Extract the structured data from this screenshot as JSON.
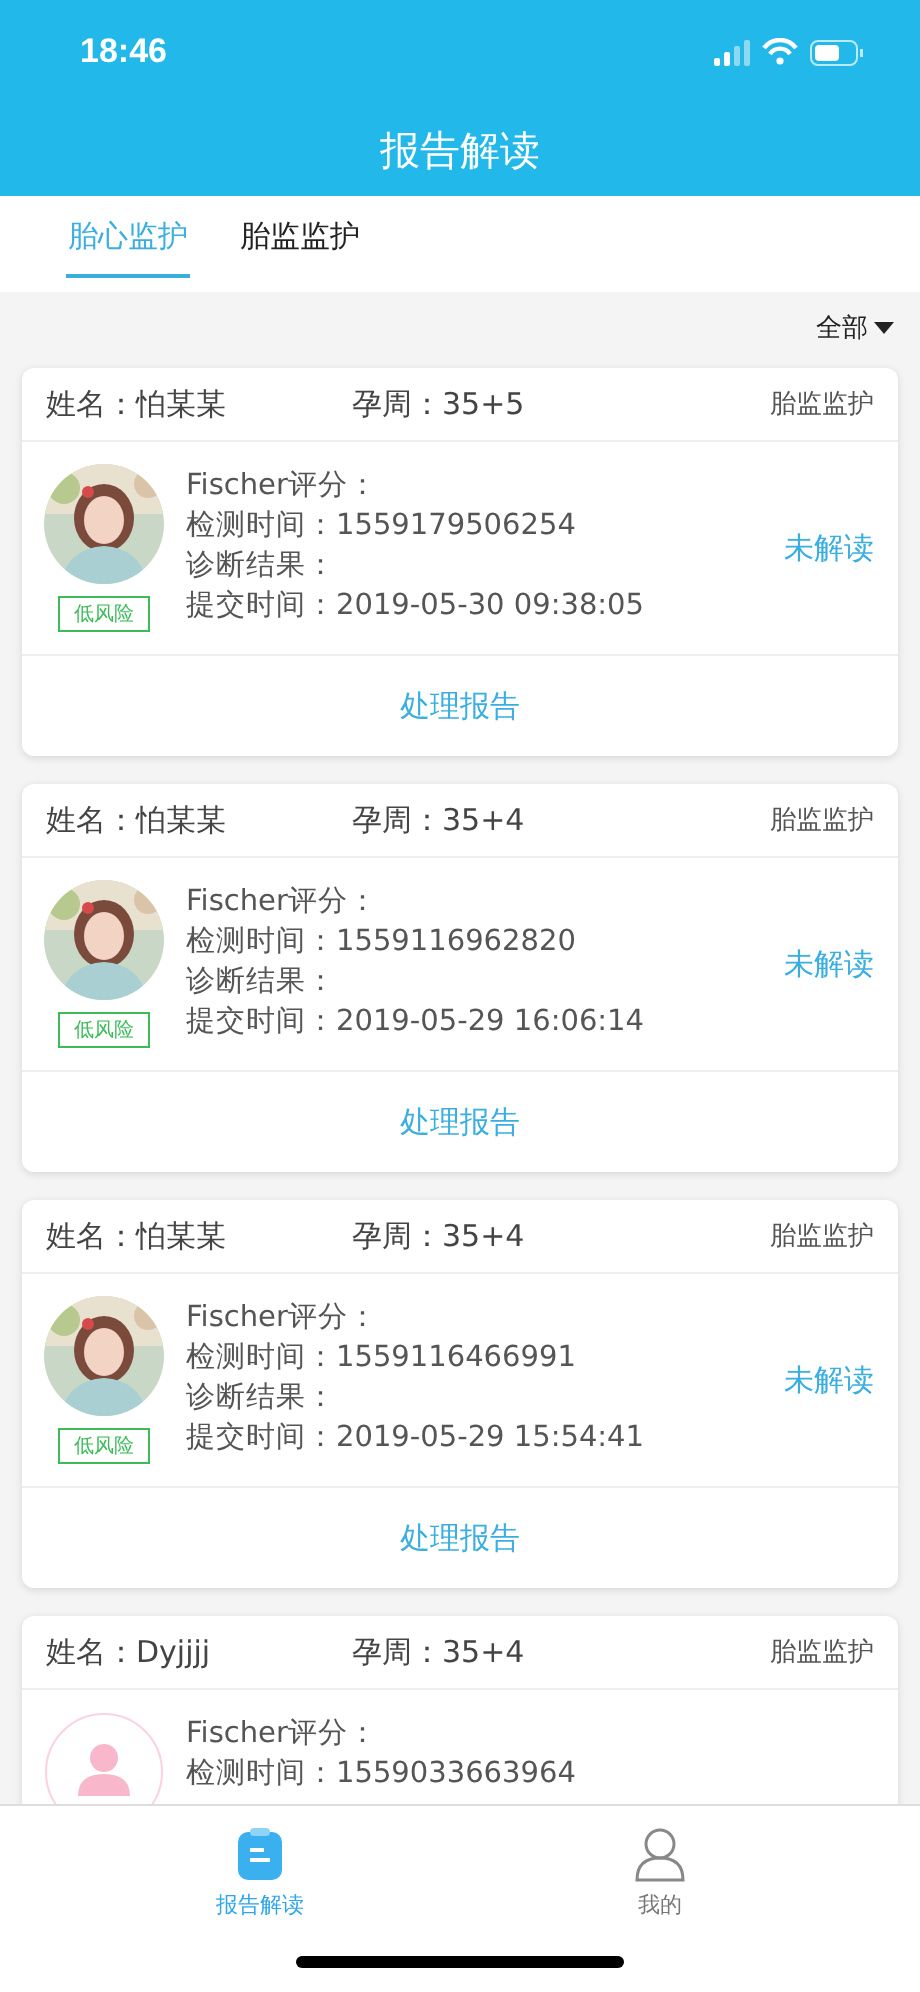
{
  "status_bar": {
    "time": "18:46"
  },
  "header": {
    "title": "报告解读"
  },
  "tabs": [
    {
      "label": "胎心监护",
      "selected": true
    },
    {
      "label": "胎监监护",
      "selected": false
    }
  ],
  "filter": {
    "label": "全部"
  },
  "reports": [
    {
      "name": "姓名：怕某某",
      "week": "孕周：35+5",
      "type": "胎监监护",
      "risk": "低风险",
      "fields": [
        "Fischer评分：",
        "检测时间：1559179506254",
        "诊断结果：",
        "提交时间：2019-05-30 09:38:05"
      ],
      "status": "未解读",
      "action": "处理报告"
    },
    {
      "name": "姓名：怕某某",
      "week": "孕周：35+4",
      "type": "胎监监护",
      "risk": "低风险",
      "fields": [
        "Fischer评分：",
        "检测时间：1559116962820",
        "诊断结果：",
        "提交时间：2019-05-29 16:06:14"
      ],
      "status": "未解读",
      "action": "处理报告"
    },
    {
      "name": "姓名：怕某某",
      "week": "孕周：35+4",
      "type": "胎监监护",
      "risk": "低风险",
      "fields": [
        "Fischer评分：",
        "检测时间：1559116466991",
        "诊断结果：",
        "提交时间：2019-05-29 15:54:41"
      ],
      "status": "未解读",
      "action": "处理报告"
    },
    {
      "name": "姓名：Dyjjjj",
      "week": "孕周：35+4",
      "type": "胎监监护",
      "avatar": {
        "kind": "placeholder"
      },
      "fields": [
        "Fischer评分：",
        "检测时间：1559033663964"
      ]
    }
  ],
  "bottom_nav": [
    {
      "kind": "report",
      "label": "报告解读",
      "selected": true
    },
    {
      "kind": "profile",
      "label": "我的",
      "selected": false
    }
  ]
}
